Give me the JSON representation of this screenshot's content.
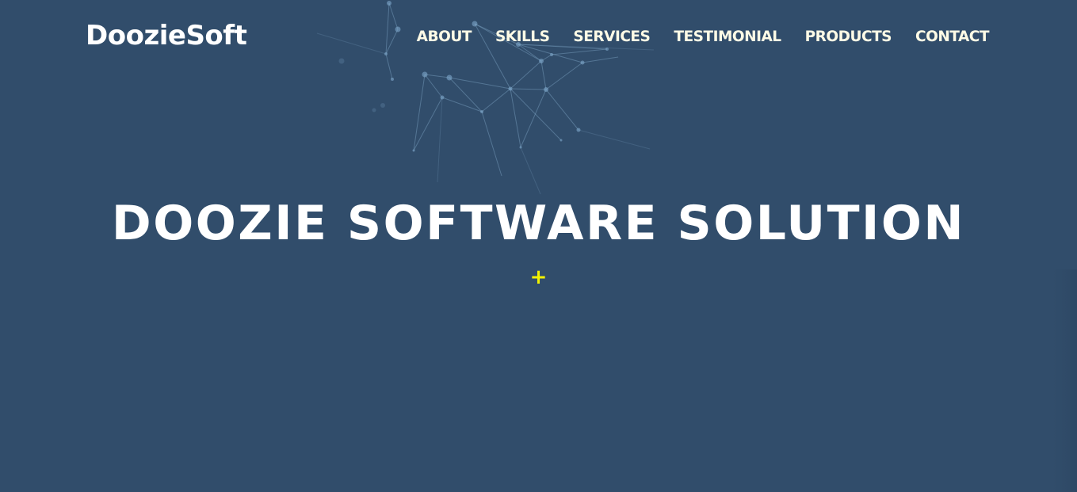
{
  "header": {
    "brand": "DoozieSoft",
    "nav": [
      {
        "label": "ABOUT"
      },
      {
        "label": "SKILLS"
      },
      {
        "label": "SERVICES"
      },
      {
        "label": "TESTIMONIAL"
      },
      {
        "label": "PRODUCTS"
      },
      {
        "label": "CONTACT"
      }
    ]
  },
  "hero": {
    "title": "DOOZIE SOFTWARE SOLUTION",
    "plus_symbol": "+"
  },
  "colors": {
    "background": "#314d6b",
    "nav_text": "#fefbe6",
    "title_text": "#ffffff",
    "accent": "#f2f200",
    "network": "#7ea8cc"
  }
}
